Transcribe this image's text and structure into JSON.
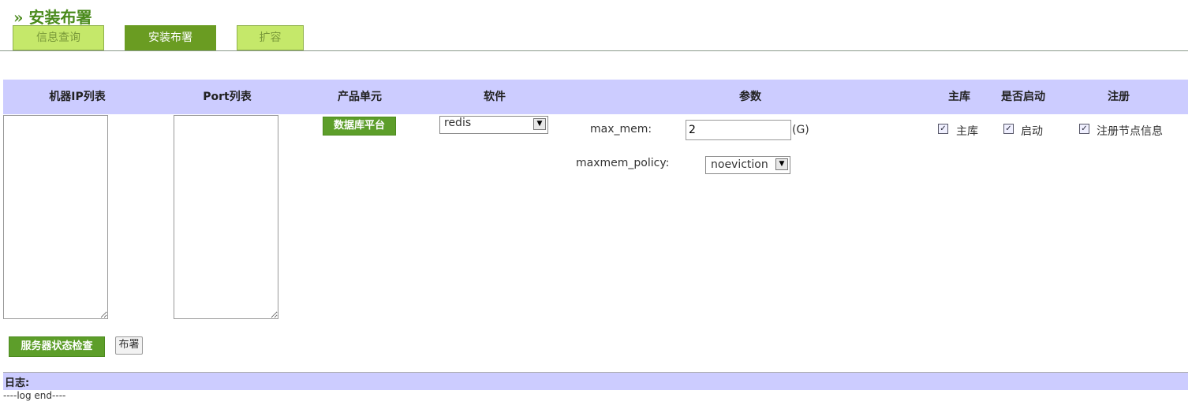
{
  "page": {
    "title": "» 安装布署"
  },
  "tabs": [
    {
      "label": "信息查询",
      "active": false
    },
    {
      "label": "安装布署",
      "active": true
    },
    {
      "label": "扩容",
      "active": false
    }
  ],
  "table_header": {
    "ip_list": "机器IP列表",
    "port_list": "Port列表",
    "product_unit": "产品单元",
    "software": "软件",
    "params": "参数",
    "master": "主库",
    "start": "是否启动",
    "register": "注册"
  },
  "row": {
    "ip_list_value": "",
    "port_list_value": "",
    "product_unit_button": "数据库平台",
    "software_select": "redis",
    "max_mem_label": "max_mem:",
    "max_mem_value": "2",
    "max_mem_unit": "(G)",
    "maxmem_policy_label": "maxmem_policy:",
    "maxmem_policy_value": "noeviction",
    "master_checkbox": {
      "label": "主库",
      "checked": true
    },
    "start_checkbox": {
      "label": "启动",
      "checked": true
    },
    "register_checkbox": {
      "label": "注册节点信息",
      "checked": true
    }
  },
  "actions": {
    "check_button": "服务器状态检查",
    "deploy_button": "布署"
  },
  "log": {
    "label": "日志:",
    "content": "----log end----"
  },
  "colors": {
    "accent_green": "#5d9e2a",
    "tab_inactive": "#c5e86a",
    "header_bg": "#ccccff"
  }
}
